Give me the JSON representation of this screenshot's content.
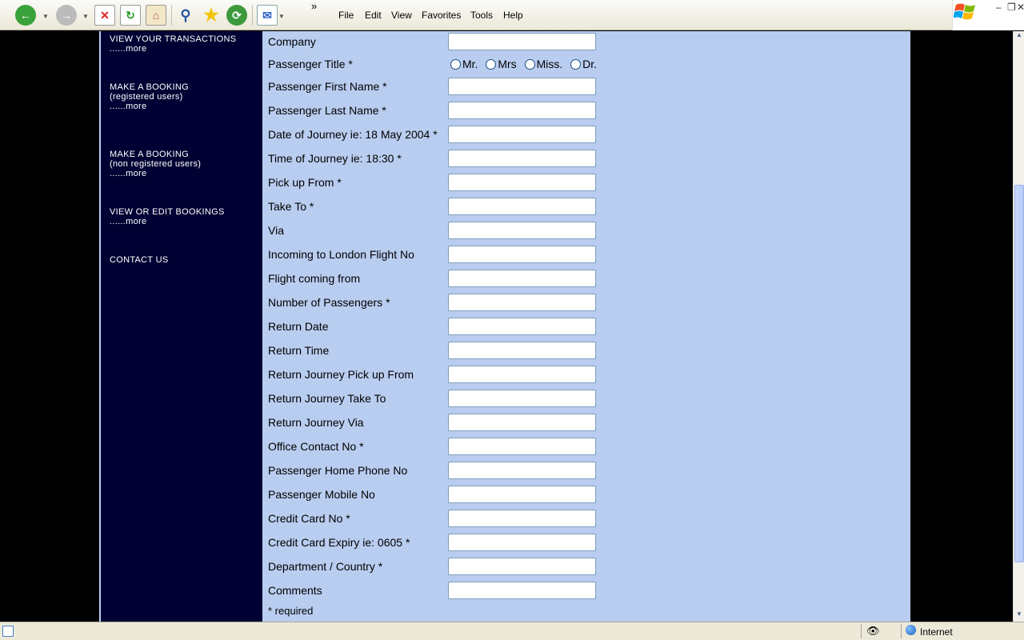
{
  "toolbar": {
    "menus": [
      "File",
      "Edit",
      "View",
      "Favorites",
      "Tools",
      "Help"
    ],
    "chevron": "»"
  },
  "sidebar": {
    "items": [
      {
        "title": "VIEW YOUR TRANSACTIONS",
        "sub": "",
        "more": "......more"
      },
      {
        "title": "MAKE A BOOKING",
        "sub": "(registered users)",
        "more": "......more"
      },
      {
        "title": "MAKE A BOOKING",
        "sub": "(non registered users)",
        "more": "......more"
      },
      {
        "title": "VIEW OR EDIT BOOKINGS",
        "sub": "",
        "more": "......more"
      },
      {
        "title": "CONTACT US",
        "sub": "",
        "more": ""
      }
    ]
  },
  "form": {
    "company_label": "Company",
    "title_label": "Passenger Title *",
    "title_options": [
      "Mr.",
      "Mrs",
      "Miss.",
      "Dr."
    ],
    "fields": [
      "Passenger First Name *",
      "Passenger Last Name *",
      "Date of Journey ie: 18 May 2004 *",
      "Time of Journey ie: 18:30 *",
      "Pick up From *",
      "Take To *",
      "Via",
      "Incoming to London Flight No",
      "Flight coming from",
      "Number of Passengers *",
      "Return Date",
      "Return Time",
      "Return Journey Pick up From",
      "Return Journey Take To",
      "Return Journey Via",
      "Office Contact No *",
      "Passenger Home Phone No",
      "Passenger Mobile No",
      "Credit Card No *",
      "Credit Card Expiry ie: 0605 *",
      "Department / Country *",
      "Comments"
    ],
    "required_note": "* required"
  },
  "statusbar": {
    "zone": "Internet"
  },
  "colors": {
    "sidebar_bg": "#000033",
    "content_bg": "#b9cdf0",
    "page_bg": "#000000"
  }
}
